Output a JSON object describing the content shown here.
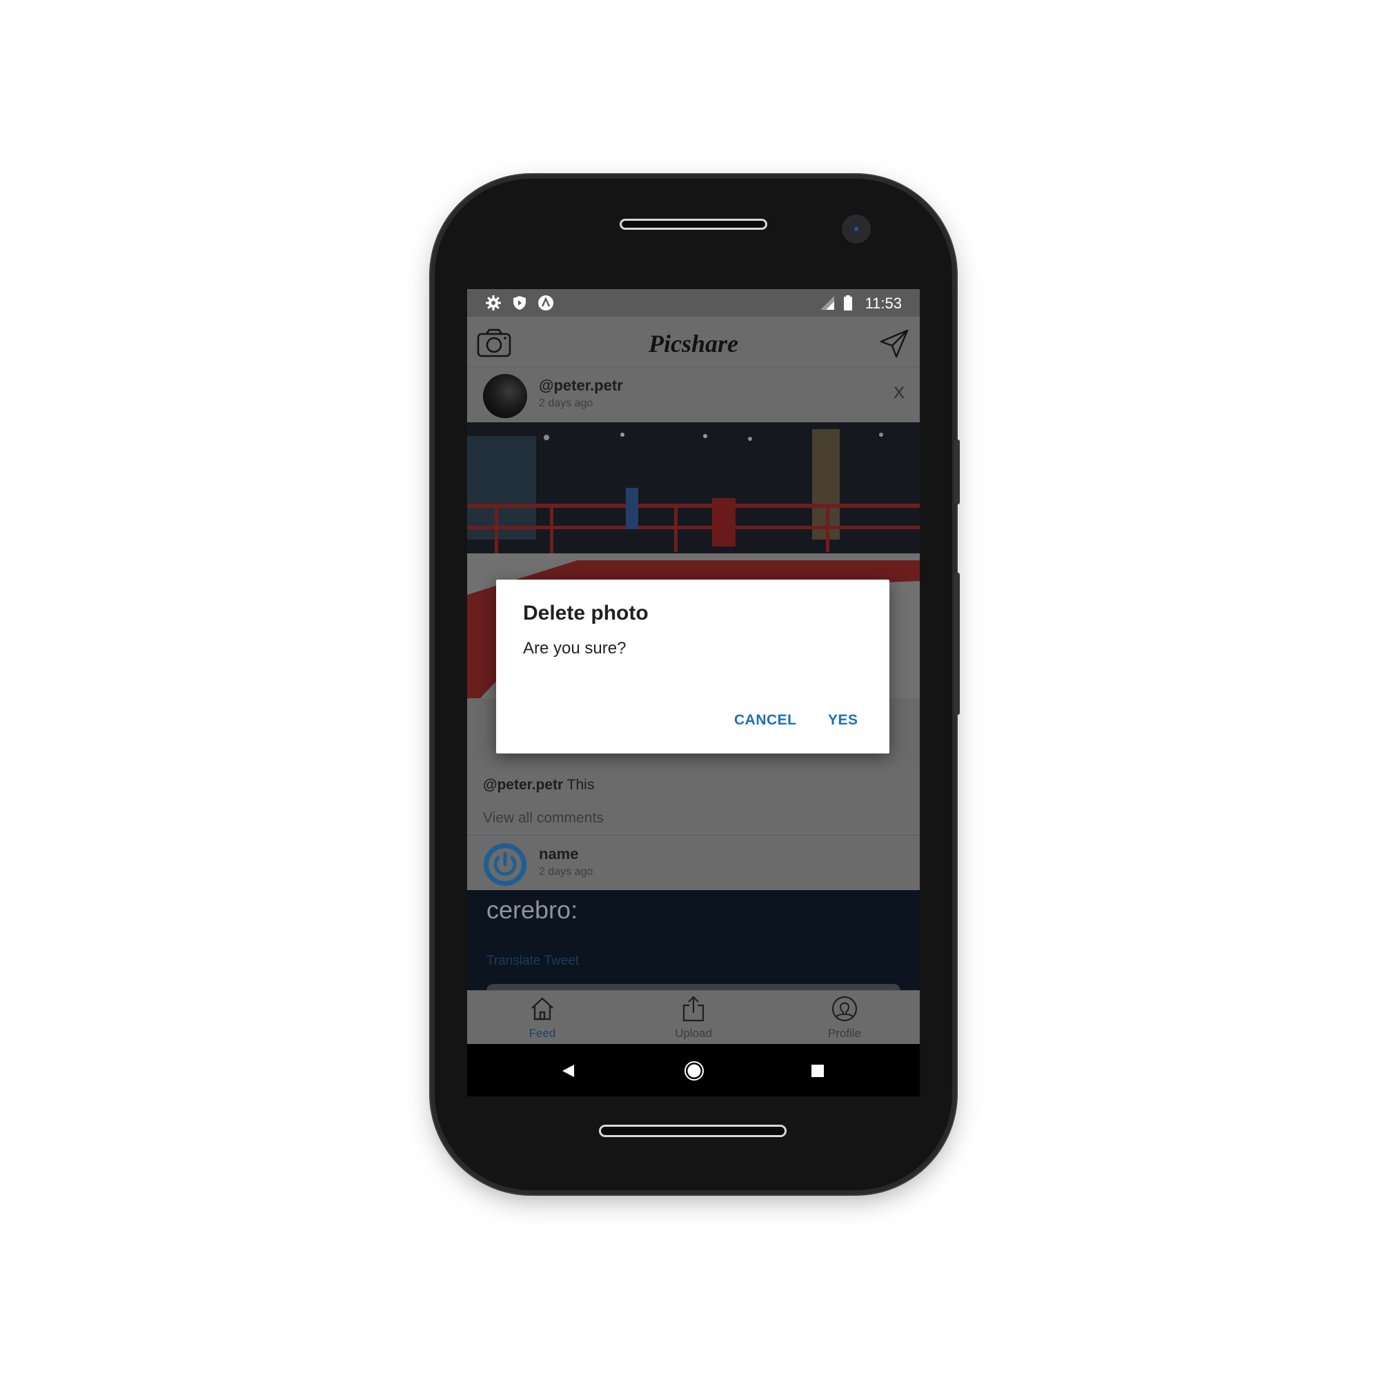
{
  "status_bar": {
    "time": "11:53",
    "left_icons": [
      "gear-icon",
      "shield-icon",
      "logo-icon"
    ],
    "right_icons": [
      "signal-icon",
      "battery-icon"
    ]
  },
  "app_bar": {
    "title": "Picshare",
    "left_icon": "camera-icon",
    "right_icon": "send-icon"
  },
  "posts": [
    {
      "username": "@peter.petr",
      "time": "2 days ago",
      "close_label": "X",
      "caption_user": "@peter.petr",
      "caption_text": "This",
      "view_comments": "View all comments"
    },
    {
      "username": "name",
      "time": "2 days ago",
      "image_text": "cerebro:",
      "image_link": "Translate Tweet"
    }
  ],
  "dialog": {
    "title": "Delete photo",
    "message": "Are you sure?",
    "cancel_label": "CANCEL",
    "confirm_label": "YES",
    "button_color": "#1f6fb8"
  },
  "bottom_nav": {
    "items": [
      {
        "label": "Feed",
        "icon": "home-icon",
        "active": true
      },
      {
        "label": "Upload",
        "icon": "upload-icon",
        "active": false
      },
      {
        "label": "Profile",
        "icon": "profile-icon",
        "active": false
      }
    ]
  },
  "android_nav": {
    "icons": [
      "back-icon",
      "home-circle-icon",
      "recents-icon"
    ]
  },
  "colors": {
    "scrim_surface": "#6b6b6b",
    "active_tab": "#1f3f6e",
    "avatar_ring": "#1e5e96"
  }
}
